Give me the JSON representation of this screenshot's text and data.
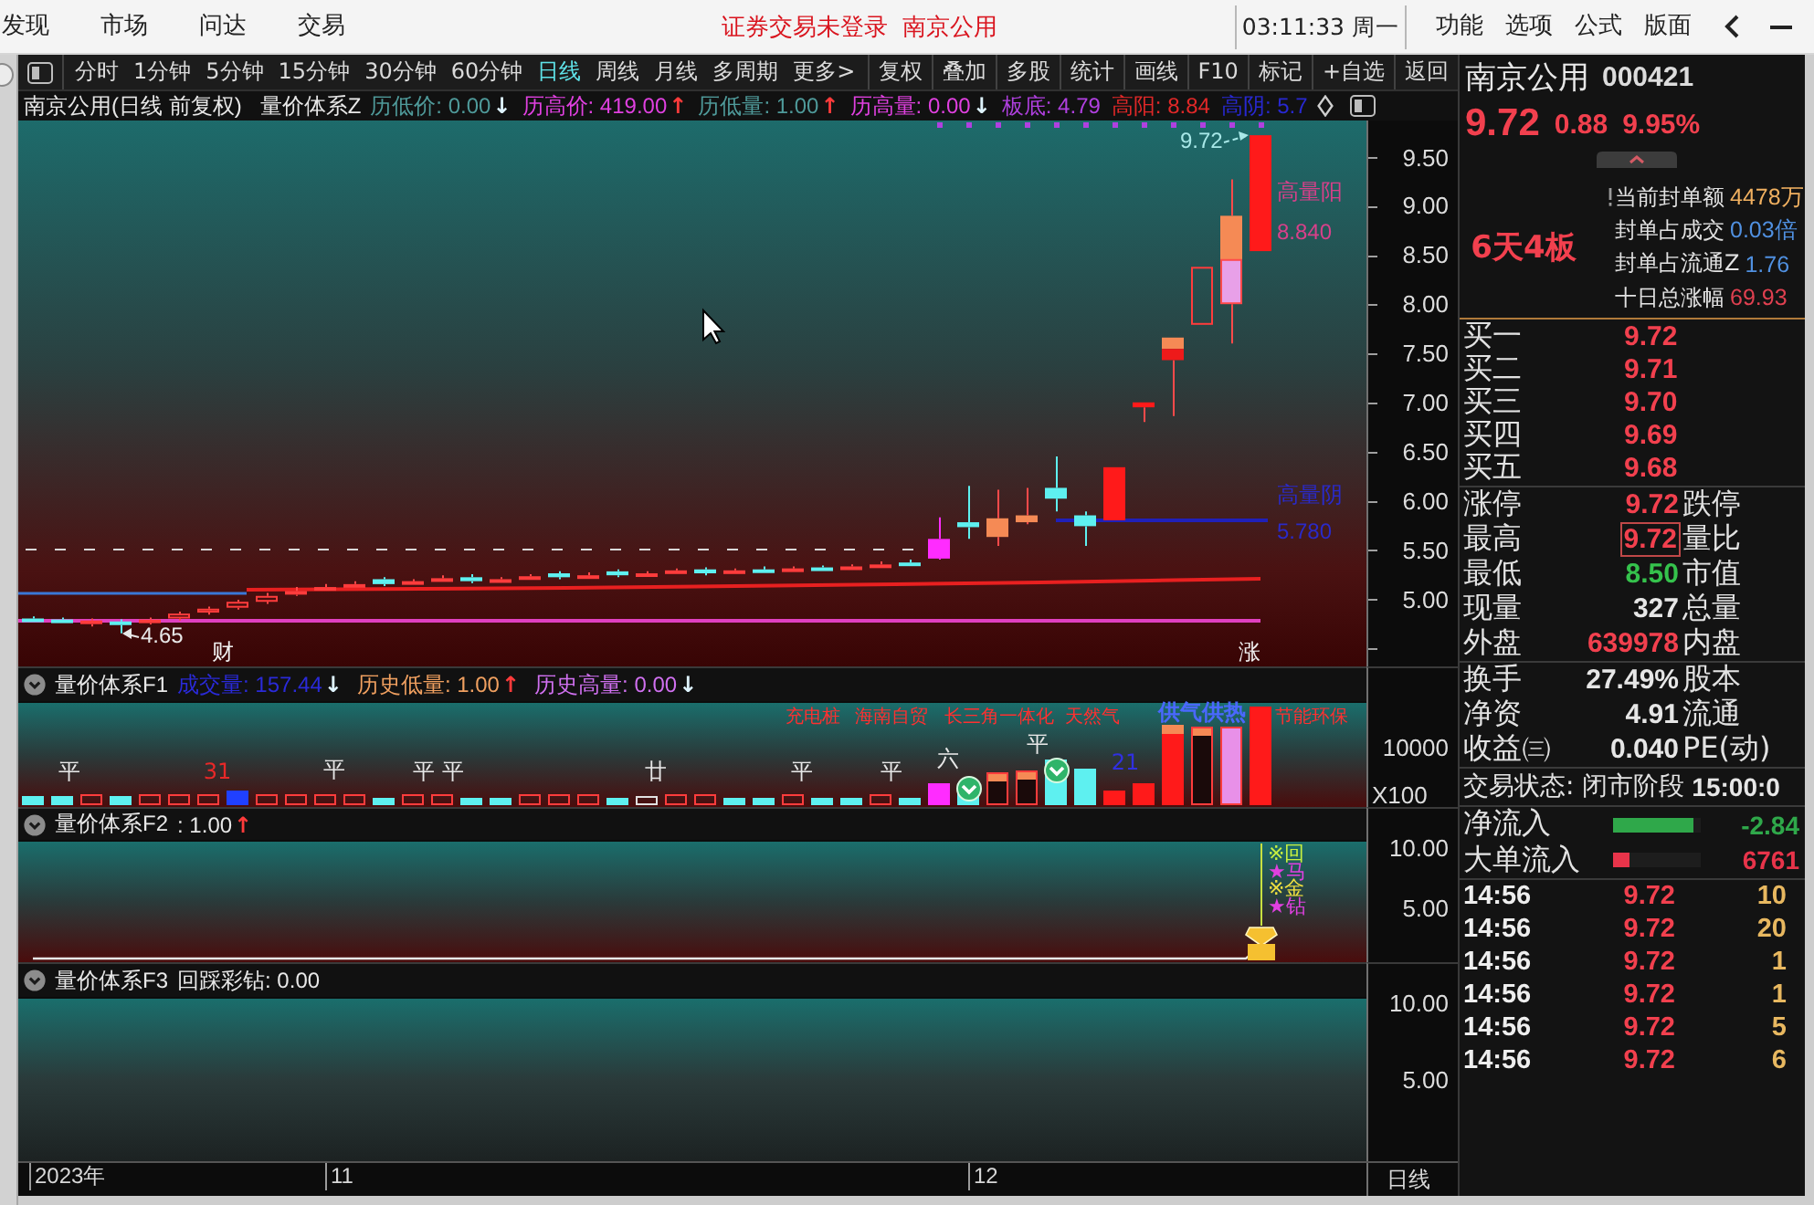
{
  "menu_bar": {
    "items": [
      "发现",
      "市场",
      "问达",
      "交易"
    ],
    "login_status": "证券交易未登录",
    "stock_name": "南京公用",
    "clock": "03:11:33 周一",
    "right_items": [
      "功能",
      "选项",
      "公式",
      "版面"
    ]
  },
  "toolbar": {
    "periods": [
      {
        "label": "分时",
        "selected": false
      },
      {
        "label": "1分钟",
        "selected": false
      },
      {
        "label": "5分钟",
        "selected": false
      },
      {
        "label": "15分钟",
        "selected": false
      },
      {
        "label": "30分钟",
        "selected": false
      },
      {
        "label": "60分钟",
        "selected": false
      },
      {
        "label": "日线",
        "selected": true
      },
      {
        "label": "周线",
        "selected": false
      },
      {
        "label": "月线",
        "selected": false
      },
      {
        "label": "多周期",
        "selected": false
      },
      {
        "label": "更多>",
        "selected": false
      }
    ],
    "actions": [
      "复权",
      "叠加",
      "多股",
      "统计",
      "画线",
      "F10",
      "标记",
      "+自选",
      "返回"
    ]
  },
  "main_chart": {
    "title": "南京公用(日线 前复权)",
    "indicator": "量价体系Z",
    "stats": [
      {
        "text": "历低价: 0.00",
        "arrow": {
          "text": "↓",
          "color": "#dff4ff"
        },
        "color": "#4f9a9a"
      },
      {
        "text": "历高价: 419.00",
        "arrow": {
          "text": "↑",
          "color": "#ff3b3b"
        },
        "color": "#e040e0"
      },
      {
        "text": "历低量: 1.00",
        "arrow": {
          "text": "↑",
          "color": "#ff3b3b"
        },
        "color": "#4f9a9a"
      },
      {
        "text": "历高量: 0.00",
        "arrow": {
          "text": "↓",
          "color": "#dff4ff"
        },
        "color": "#e040e0"
      },
      {
        "text": "板底: 4.79",
        "color": "#b040e0"
      },
      {
        "text": "高阳: 8.84",
        "color": "#e02828"
      },
      {
        "text": "高阴: 5.7",
        "color": "#2828d0"
      }
    ],
    "price_axis": [
      "9.50",
      "9.00",
      "8.50",
      "8.00",
      "7.50",
      "7.00",
      "6.50",
      "6.00",
      "5.50",
      "5.00"
    ],
    "labels": [
      {
        "text": "9.72",
        "color": "#a8e8e8"
      },
      {
        "text": "高量阳",
        "color": "#d8408a"
      },
      {
        "text": "8.840",
        "color": "#d8408a"
      },
      {
        "text": "高量阴",
        "color": "#2a2ac8"
      },
      {
        "text": "5.780",
        "color": "#2a2ac8"
      },
      {
        "text": "4.65",
        "color": "#e8e8e8"
      },
      {
        "text": "财",
        "color": "#f0f0f0"
      },
      {
        "text": "涨",
        "color": "#f0f0f0"
      }
    ]
  },
  "indicator_panels": [
    {
      "kind": "volume",
      "name": "量价体系F1",
      "stats": [
        {
          "text": "成交量: 157.44",
          "arrow": {
            "text": "↓",
            "color": "#dff4ff"
          },
          "color": "#2a2ad8"
        },
        {
          "text": "历史低量: 1.00",
          "arrow": {
            "text": "↑",
            "color": "#ff3b3b"
          },
          "color": "#f0a060"
        },
        {
          "text": "历史高量: 0.00",
          "arrow": {
            "text": "↓",
            "color": "#dff4ff"
          },
          "color": "#d070f0"
        }
      ],
      "axis": [
        "10000"
      ],
      "unit": "X100",
      "tags": [
        {
          "text": "充电桩",
          "color": "#ff3030"
        },
        {
          "text": "海南自贸",
          "color": "#ff3030"
        },
        {
          "text": "长三角一体化",
          "color": "#ff3030"
        },
        {
          "text": "天然气",
          "color": "#ff3030"
        },
        {
          "text": "供气供热",
          "color": "#4a68ff"
        },
        {
          "text": "节能环保",
          "color": "#ff3030"
        }
      ],
      "labels": [
        {
          "text": "平",
          "color": "#e8e8e8"
        },
        {
          "text": "31",
          "color": "#e82828"
        },
        {
          "text": "平",
          "color": "#e8e8e8"
        },
        {
          "text": "平",
          "color": "#e8e8e8"
        },
        {
          "text": "平",
          "color": "#e8e8e8"
        },
        {
          "text": "廿",
          "color": "#e8e8e8"
        },
        {
          "text": "平",
          "color": "#e8e8e8"
        },
        {
          "text": "平",
          "color": "#e8e8e8"
        },
        {
          "text": "六",
          "color": "#e8e8e8"
        },
        {
          "text": "平",
          "color": "#e8e8e8"
        },
        {
          "text": "21",
          "color": "#3030e0"
        }
      ]
    },
    {
      "kind": "signals",
      "name": "量价体系F2",
      "stats": [
        {
          "text": ": 1.00",
          "arrow": {
            "text": "↑",
            "color": "#ff3b3b"
          },
          "color": "#e8e8e8"
        }
      ],
      "axis": [
        "10.00",
        "5.00"
      ],
      "signals": [
        {
          "text": "※回",
          "color": "#c8f040"
        },
        {
          "text": "★马",
          "color": "#e040e0"
        },
        {
          "text": "※金",
          "color": "#f0e040"
        },
        {
          "text": "★钻",
          "color": "#e040e0"
        }
      ]
    },
    {
      "kind": "plain",
      "name": "量价体系F3",
      "stats": [
        {
          "text": "回踩彩钻: 0.00",
          "color": "#e8e8e8"
        }
      ],
      "axis": [
        "10.00",
        "5.00"
      ]
    }
  ],
  "date_axis": {
    "labels": [
      "2023年",
      "11",
      "12"
    ],
    "period": "日线"
  },
  "quote": {
    "name": "南京公用",
    "code": "000421",
    "price": "9.72",
    "change": "0.88",
    "change_pct": "9.95%",
    "streak": "6天4板",
    "seal": [
      {
        "label": "当前封单额",
        "value": "4478万",
        "color": "#f0b060"
      },
      {
        "label": "封单占成交",
        "value": "0.03倍",
        "color": "#5090e0"
      },
      {
        "label": "封单占流通Z",
        "value": "1.76",
        "color": "#5090e0"
      },
      {
        "label": "十日总涨幅",
        "value": "69.93",
        "color": "#e04050"
      }
    ],
    "bids": [
      {
        "label": "买一",
        "price": "9.72"
      },
      {
        "label": "买二",
        "price": "9.71"
      },
      {
        "label": "买三",
        "price": "9.70"
      },
      {
        "label": "买四",
        "price": "9.69"
      },
      {
        "label": "买五",
        "price": "9.68"
      }
    ],
    "stats": [
      {
        "label": "涨停",
        "value": "9.72",
        "color": "#f2404e",
        "boxed": false,
        "label_2": "跌停"
      },
      {
        "label": "最高",
        "value": "9.72",
        "color": "#f2404e",
        "boxed": true,
        "label_2": "量比"
      },
      {
        "label": "最低",
        "value": "8.50",
        "color": "#35c24c",
        "boxed": false,
        "label_2": "市值"
      },
      {
        "label": "现量",
        "value": "327",
        "color": "#e6e6e6",
        "boxed": false,
        "label_2": "总量"
      },
      {
        "label": "外盘",
        "value": "639978",
        "color": "#f2404e",
        "boxed": false,
        "label_2": "内盘"
      }
    ],
    "fundamentals": [
      {
        "label": "换手",
        "value": "27.49%",
        "label_2": "股本"
      },
      {
        "label": "净资",
        "value": "4.91",
        "label_2": "流通"
      },
      {
        "label": "收益㈢",
        "value": "0.040",
        "label_2": "PE(动)"
      }
    ],
    "status": {
      "label": "交易状态: 闭市阶段",
      "time": "15:00:0"
    },
    "flows": [
      {
        "label": "净流入",
        "value": "-2.84",
        "color": "#2fa84a",
        "level": 0.92
      },
      {
        "label": "大单流入",
        "value": "6761",
        "color": "#e8344a",
        "level": 0.19
      }
    ],
    "ticks": [
      {
        "time": "14:56",
        "price": "9.72",
        "volume": "10"
      },
      {
        "time": "14:56",
        "price": "9.72",
        "volume": "20"
      },
      {
        "time": "14:56",
        "price": "9.72",
        "volume": "1"
      },
      {
        "time": "14:56",
        "price": "9.72",
        "volume": "1"
      },
      {
        "time": "14:56",
        "price": "9.72",
        "volume": "5"
      },
      {
        "time": "14:56",
        "price": "9.72",
        "volume": "6"
      }
    ]
  }
}
